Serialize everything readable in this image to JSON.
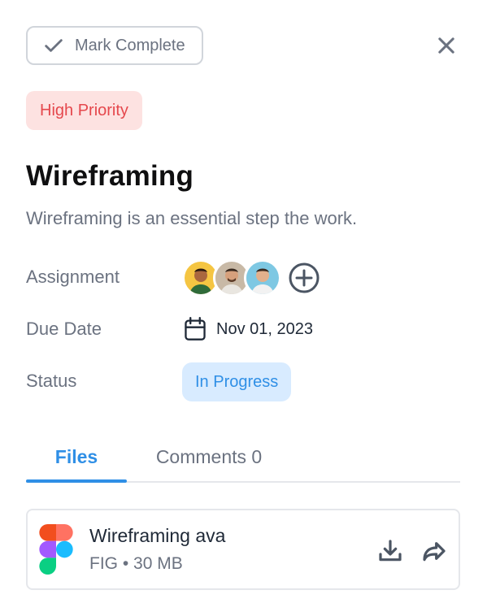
{
  "header": {
    "mark_complete_label": "Mark Complete"
  },
  "task": {
    "priority": "High Priority",
    "title": "Wireframing",
    "description": "Wireframing is an essential step the work."
  },
  "details": {
    "assignment_label": "Assignment",
    "due_date_label": "Due Date",
    "due_date_value": "Nov 01, 2023",
    "status_label": "Status",
    "status_value": "In Progress",
    "assignees": [
      {
        "name": "avatar-1",
        "bg": "#f5c542"
      },
      {
        "name": "avatar-2",
        "bg": "#c8b9a6"
      },
      {
        "name": "avatar-3",
        "bg": "#7ec8e3"
      }
    ]
  },
  "tabs": {
    "files": "Files",
    "comments": "Comments 0"
  },
  "files": [
    {
      "name": "Wireframing ava",
      "meta": "FIG • 30 MB",
      "icon": "figma-icon"
    }
  ],
  "colors": {
    "accent": "#2f8fe6",
    "priority_bg": "#fde2e1",
    "priority_text": "#e5484d",
    "status_bg": "#d8ebff",
    "muted_text": "#6b7280"
  }
}
